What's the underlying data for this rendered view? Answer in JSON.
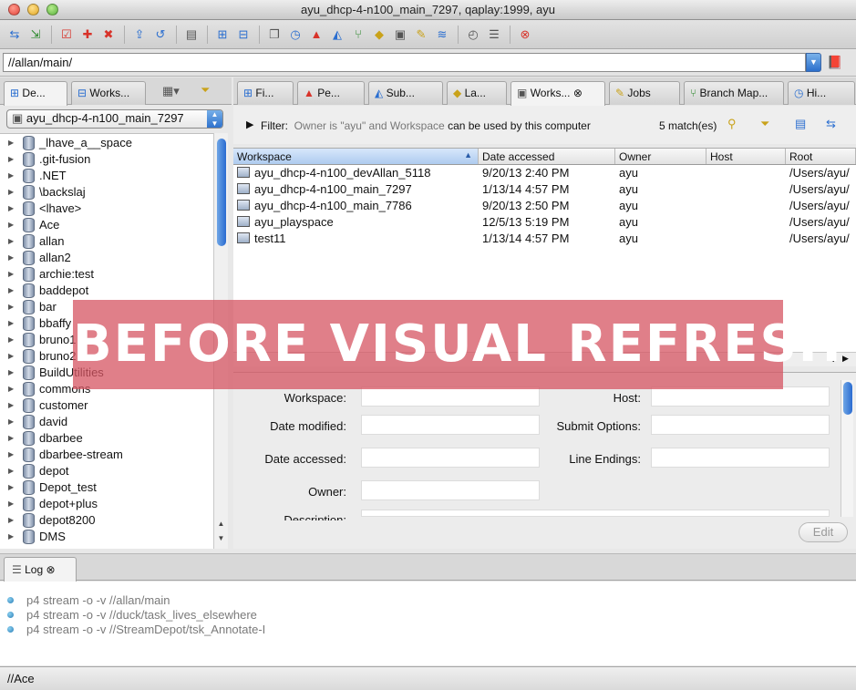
{
  "window": {
    "title": "ayu_dhcp-4-n100_main_7297,  qaplay:1999,  ayu"
  },
  "toolbar": {
    "icons": [
      "sync-icon",
      "add-icon",
      "checkout-icon",
      "add-file-icon",
      "delete-icon",
      "submit-icon",
      "revert-icon",
      "diff-icon",
      "tree-icon",
      "branch-icon",
      "copy-icon",
      "clock-icon",
      "warning-icon",
      "merge-icon",
      "fork-icon",
      "label-icon",
      "workspace-icon",
      "tools-icon",
      "stream-icon",
      "timer-icon",
      "notes-icon",
      "stop-icon"
    ]
  },
  "path": {
    "value": "//allan/main/"
  },
  "left": {
    "tabs": [
      {
        "label": "De..."
      },
      {
        "label": "Works..."
      }
    ],
    "selected_workspace": "ayu_dhcp-4-n100_main_7297",
    "depots": [
      "_lhave_a__space",
      ".git-fusion",
      ".NET",
      "\\backslaj",
      "<lhave>",
      "Ace",
      "allan",
      "allan2",
      "archie:test",
      "baddepot",
      "bar",
      "bbaffy",
      "bruno1",
      "bruno2",
      "BuildUtilities",
      "commons",
      "customer",
      "david",
      "dbarbee",
      "dbarbee-stream",
      "depot",
      "Depot_test",
      "depot+plus",
      "depot8200",
      "DMS"
    ]
  },
  "right": {
    "tabs": [
      {
        "label": "Fi..."
      },
      {
        "label": "Pe..."
      },
      {
        "label": "Sub..."
      },
      {
        "label": "La..."
      },
      {
        "label": "Works..."
      },
      {
        "label": "Jobs"
      },
      {
        "label": "Branch Map..."
      },
      {
        "label": "Hi..."
      }
    ],
    "filter": {
      "prefix": "Filter:",
      "owner_text": "Owner is \"ayu\" and Workspace",
      "rest_text": "can be used by this computer",
      "matches": "5 match(es)"
    },
    "columns": [
      "Workspace",
      "Date accessed",
      "Owner",
      "Host",
      "Root"
    ],
    "rows": [
      {
        "workspace": "ayu_dhcp-4-n100_devAllan_5118",
        "date": "9/20/13 2:40 PM",
        "owner": "ayu",
        "host": "",
        "root": "/Users/ayu/"
      },
      {
        "workspace": "ayu_dhcp-4-n100_main_7297",
        "date": "1/13/14 4:57 PM",
        "owner": "ayu",
        "host": "",
        "root": "/Users/ayu/"
      },
      {
        "workspace": "ayu_dhcp-4-n100_main_7786",
        "date": "9/20/13 2:50 PM",
        "owner": "ayu",
        "host": "",
        "root": "/Users/ayu/"
      },
      {
        "workspace": "ayu_playspace",
        "date": "12/5/13 5:19 PM",
        "owner": "ayu",
        "host": "",
        "root": "/Users/ayu/"
      },
      {
        "workspace": "test11",
        "date": "1/13/14 4:57 PM",
        "owner": "ayu",
        "host": "",
        "root": "/Users/ayu/"
      }
    ],
    "details": {
      "workspace_label": "Workspace:",
      "host_label": "Host:",
      "date_modified_label": "Date modified:",
      "submit_options_label": "Submit Options:",
      "date_accessed_label": "Date accessed:",
      "line_endings_label": "Line Endings:",
      "owner_label": "Owner:",
      "description_label": "Description:",
      "edit_button": "Edit"
    }
  },
  "log": {
    "tab_label": "Log",
    "lines": [
      "p4 stream -o -v //allan/main",
      "p4 stream -o -v //duck/task_lives_elsewhere",
      "p4 stream -o -v //StreamDepot/tsk_Annotate-I"
    ]
  },
  "status": {
    "text": "//Ace"
  },
  "overlay": {
    "text": "BEFORE VISUAL REFRESH"
  }
}
